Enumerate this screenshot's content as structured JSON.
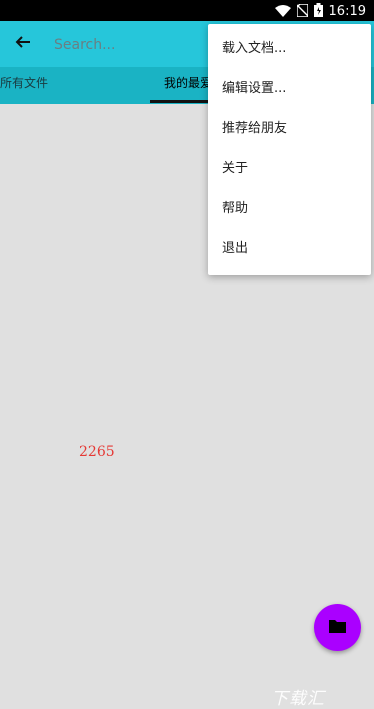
{
  "status_bar": {
    "time": "16:19",
    "icons": [
      "wifi-icon",
      "no-sim-icon",
      "battery-icon"
    ]
  },
  "toolbar": {
    "back_icon": "arrow-left-icon",
    "search_placeholder": "Search..."
  },
  "tabs": [
    {
      "label": "所有文件",
      "selected": false
    },
    {
      "label": "我的最爱",
      "selected": true
    }
  ],
  "menu": {
    "items": [
      {
        "label": "载入文档..."
      },
      {
        "label": "编辑设置..."
      },
      {
        "label": "推荐给朋友"
      },
      {
        "label": "关于"
      },
      {
        "label": "帮助"
      },
      {
        "label": "退出"
      }
    ]
  },
  "content": {
    "count_label": "2265",
    "watermark": "下载汇"
  },
  "fab": {
    "icon": "folder-icon"
  },
  "colors": {
    "toolbar": "#26c6da",
    "tabs": "#1ab3c4",
    "fab": "#aa00ff",
    "count_label": "#e53935"
  }
}
